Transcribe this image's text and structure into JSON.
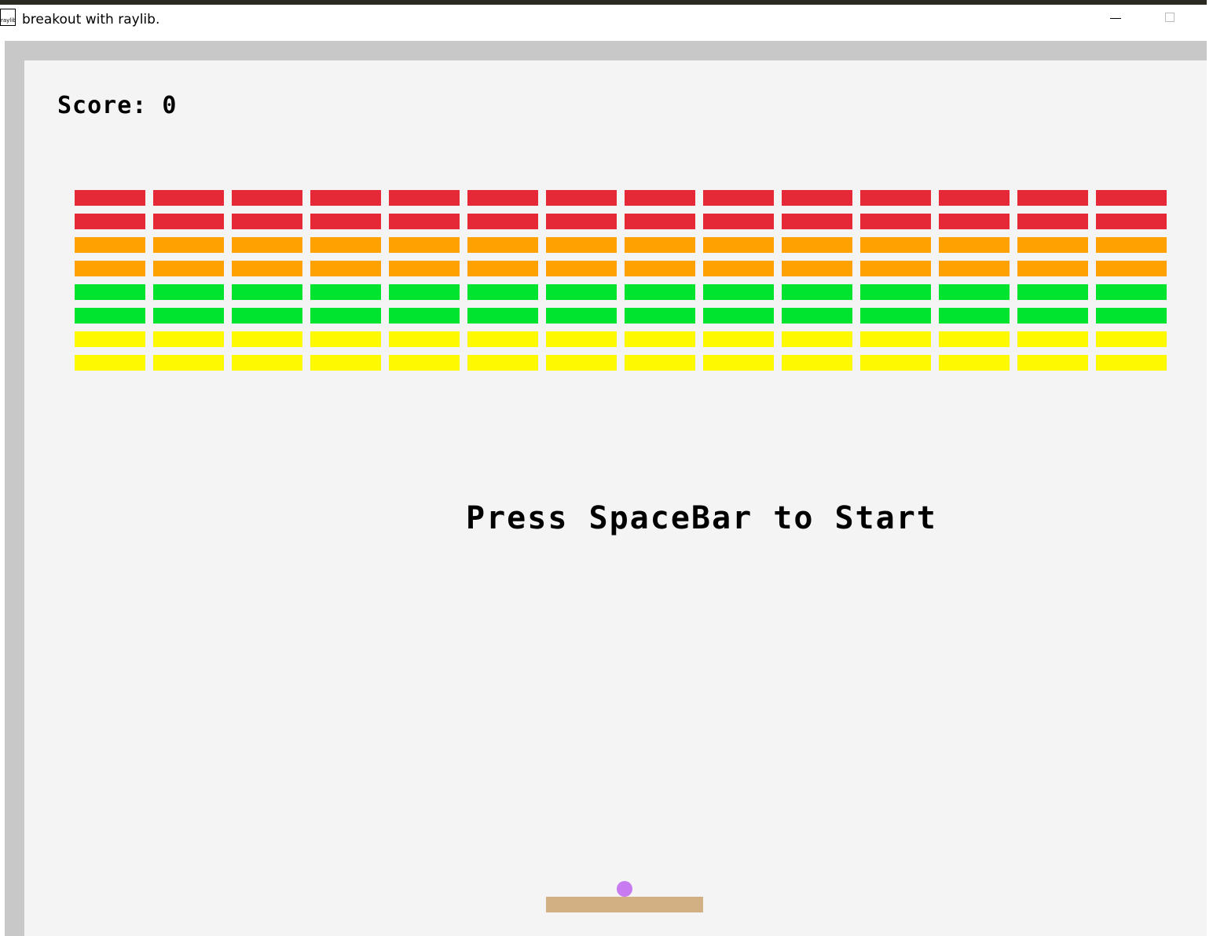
{
  "window": {
    "title": "breakout with raylib.",
    "icon_label": "raylib",
    "icon_name": "raylib-app-icon"
  },
  "hud": {
    "score_label": "Score: 0",
    "start_prompt": "Press SpaceBar to Start"
  },
  "colors": {
    "background": "#f4f4f4",
    "frame": "#c8c8c8",
    "red": "#e62937",
    "orange": "#ffa100",
    "green": "#00e430",
    "yellow": "#fdf900",
    "ball": "#c87af0",
    "paddle": "#d3b083"
  },
  "bricks": {
    "columns": 14,
    "row_colors": [
      "red",
      "red",
      "orange",
      "orange",
      "green",
      "green",
      "yellow",
      "yellow"
    ]
  }
}
